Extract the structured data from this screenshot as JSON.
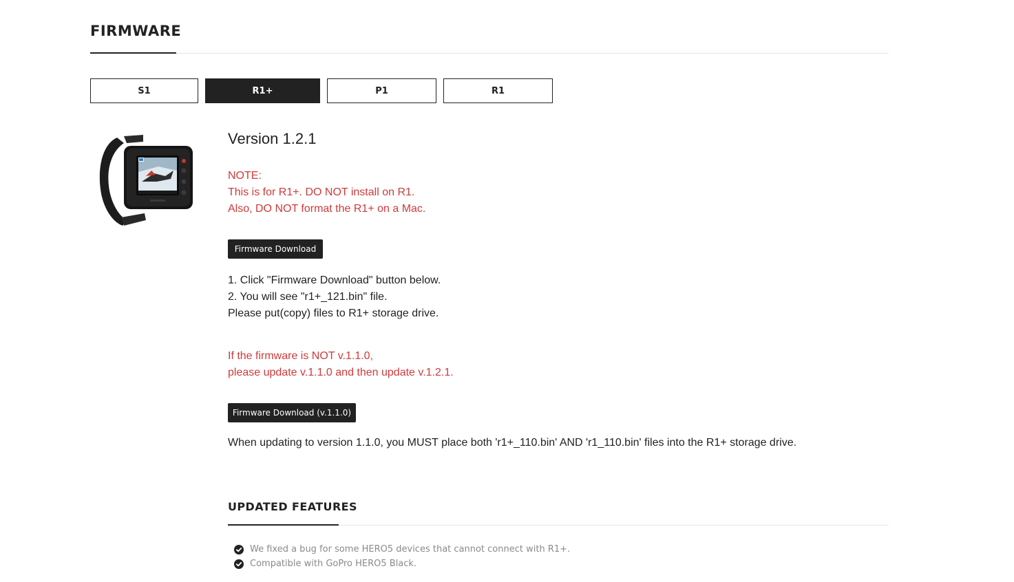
{
  "section": {
    "title": "FIRMWARE"
  },
  "tabs": [
    {
      "label": "S1",
      "active": false
    },
    {
      "label": "R1+",
      "active": true
    },
    {
      "label": "P1",
      "active": false
    },
    {
      "label": "R1",
      "active": false
    }
  ],
  "firmware": {
    "version": "Version 1.2.1",
    "note_lines": [
      "NOTE:",
      "This is for R1+. DO NOT install on R1.",
      "Also, DO NOT format the R1+ on a Mac."
    ],
    "download_label": "Firmware Download",
    "steps": [
      "1. Click \"Firmware Download\" button below.",
      "2. You will see \"r1+_121.bin\" file.",
      "Please put(copy) files to R1+ storage drive."
    ],
    "warning_lines": [
      "If the firmware is NOT v.1.1.0,",
      "please update v.1.1.0 and then update v.1.2.1."
    ],
    "download_110_label": "Firmware Download (v.1.1.0)",
    "must_note": "When updating to version 1.1.0, you MUST place both 'r1+_110.bin' AND 'r1_110.bin' files into the R1+ storage drive."
  },
  "features": {
    "title": "UPDATED FEATURES",
    "items": [
      "We fixed a bug for some HERO5 devices that cannot connect with R1+.",
      "Compatible with GoPro HERO5 Black."
    ]
  },
  "colors": {
    "text": "#222222",
    "warning_red": "#d03a3a",
    "button_dark": "#222222",
    "feature_text": "#8a8a8a"
  },
  "icons": {
    "feature_bullet": "check-circle-icon",
    "product": "wrist-remote-device-image"
  }
}
